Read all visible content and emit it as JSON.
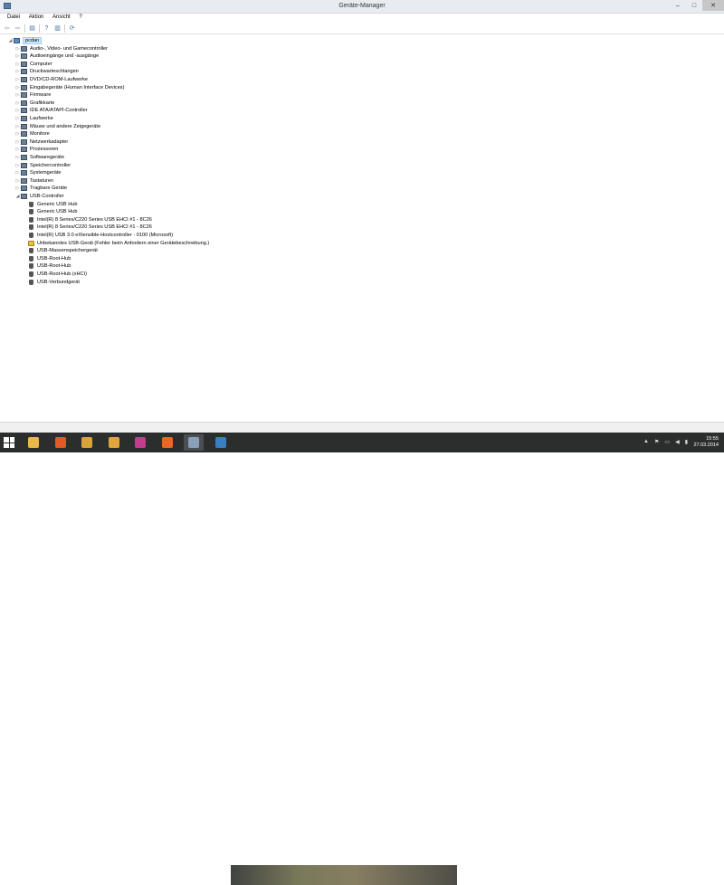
{
  "window": {
    "title": "Geräte-Manager",
    "controls": {
      "minimize": "–",
      "maximize": "□",
      "close": "✕"
    }
  },
  "menu": [
    "Datei",
    "Aktion",
    "Ansicht",
    "?"
  ],
  "toolbar": [
    {
      "icon": "back-arrow-icon",
      "glyph": "⇦"
    },
    {
      "icon": "forward-arrow-icon",
      "glyph": "⇨"
    },
    {
      "icon": "device-list-icon",
      "glyph": "▤"
    },
    {
      "icon": "help-icon",
      "glyph": "?"
    },
    {
      "icon": "properties-icon",
      "glyph": "▥"
    },
    {
      "icon": "scan-hardware-icon",
      "glyph": "⟳"
    }
  ],
  "tree": {
    "root": {
      "label": "pcdan",
      "icon": "computer-icon",
      "expanded": true
    },
    "categories": [
      {
        "label": "Audio-, Video- und Gamecontroller",
        "icon": "speaker-icon"
      },
      {
        "label": "Audioeingänge und -ausgänge",
        "icon": "speaker-icon"
      },
      {
        "label": "Computer",
        "icon": "computer-icon"
      },
      {
        "label": "Druckwarteschlangen",
        "icon": "printer-icon"
      },
      {
        "label": "DVD/CD-ROM-Laufwerke",
        "icon": "disc-icon"
      },
      {
        "label": "Eingabegeräte (Human Interface Devices)",
        "icon": "hid-icon"
      },
      {
        "label": "Firmware",
        "icon": "firmware-icon"
      },
      {
        "label": "Grafikkarte",
        "icon": "display-adapter-icon"
      },
      {
        "label": "IDE ATA/ATAPI-Controller",
        "icon": "ide-icon"
      },
      {
        "label": "Laufwerke",
        "icon": "drive-icon"
      },
      {
        "label": "Mäuse und andere Zeigegeräte",
        "icon": "mouse-icon"
      },
      {
        "label": "Monitore",
        "icon": "monitor-icon"
      },
      {
        "label": "Netzwerkadapter",
        "icon": "network-icon"
      },
      {
        "label": "Prozessoren",
        "icon": "processor-icon"
      },
      {
        "label": "Softwaregeräte",
        "icon": "software-device-icon"
      },
      {
        "label": "Speichercontroller",
        "icon": "storage-icon"
      },
      {
        "label": "Systemgeräte",
        "icon": "system-icon"
      },
      {
        "label": "Tastaturen",
        "icon": "keyboard-icon"
      },
      {
        "label": "Tragbare Geräte",
        "icon": "portable-device-icon"
      },
      {
        "label": "USB-Controller",
        "icon": "usb-icon",
        "expanded": true
      }
    ],
    "usb_children": [
      {
        "label": "Generic USB Hub",
        "warning": false
      },
      {
        "label": "Generic USB Hub",
        "warning": false
      },
      {
        "label": "Intel(R) 8 Series/C220 Series USB EHCI #1 - 8C26",
        "warning": false
      },
      {
        "label": "Intel(R) 8 Series/C220 Series USB EHCI #1 - 8C26",
        "warning": false
      },
      {
        "label": "Intel(R) USB 3.0 eXtensible-Hostcontroller - 0100 (Microsoft)",
        "warning": false
      },
      {
        "label": "Unbekanntes USB-Gerät (Fehler beim Anfordern einer Gerätebeschreibung.)",
        "warning": true
      },
      {
        "label": "USB-Massenspeichergerät",
        "warning": false
      },
      {
        "label": "USB-Root-Hub",
        "warning": false
      },
      {
        "label": "USB-Root-Hub",
        "warning": false
      },
      {
        "label": "USB-Root-Hub (xHCI)",
        "warning": false
      },
      {
        "label": "USB-Verbundgerät",
        "warning": false
      }
    ]
  },
  "taskbar": {
    "apps": [
      {
        "name": "explorer-icon",
        "color": "#e8b84a"
      },
      {
        "name": "office-icon",
        "color": "#e05a24"
      },
      {
        "name": "paint-icon",
        "color": "#d9a23a"
      },
      {
        "name": "media-player-icon",
        "color": "#e0a63c"
      },
      {
        "name": "photo-gallery-icon",
        "color": "#c43c8c"
      },
      {
        "name": "firefox-icon",
        "color": "#e66a1f"
      },
      {
        "name": "device-manager-icon",
        "color": "#8aa0b8"
      },
      {
        "name": "app-icon",
        "color": "#3a7fc0"
      }
    ],
    "tray_glyphs": [
      "▲",
      "⚑",
      "▭",
      "◀",
      "▮"
    ],
    "time": "15:55",
    "date": "27.03.2014"
  }
}
